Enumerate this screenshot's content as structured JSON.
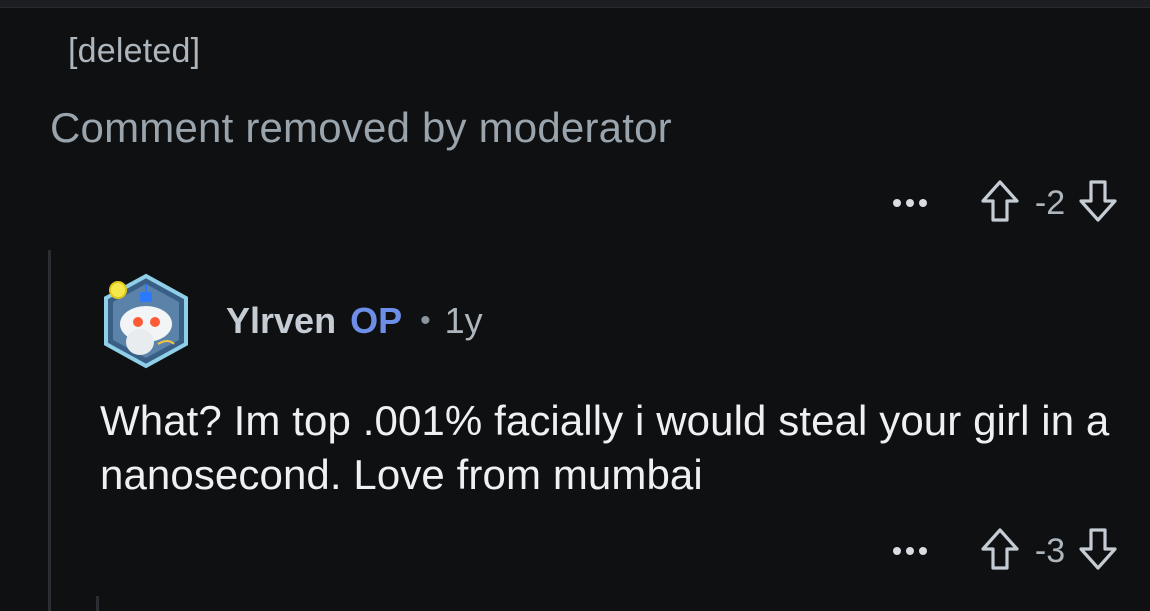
{
  "comment1": {
    "author": "[deleted]",
    "body": "Comment removed by moderator",
    "score": "-2",
    "more_icon": "more-icon",
    "upvote_icon": "upvote-arrow-icon",
    "downvote_icon": "downvote-arrow-icon"
  },
  "comment2": {
    "username": "Ylrven",
    "op_badge": "OP",
    "separator": "•",
    "age": "1y",
    "body": "What? Im top .001% facially i would steal your girl in a nanosecond. Love from mumbai",
    "score": "-3",
    "avatar_icon": "snoo-avatar-icon"
  },
  "colors": {
    "background": "#0f1012",
    "op_badge": "#6e8fe8",
    "muted_text": "#aeb6bd"
  }
}
